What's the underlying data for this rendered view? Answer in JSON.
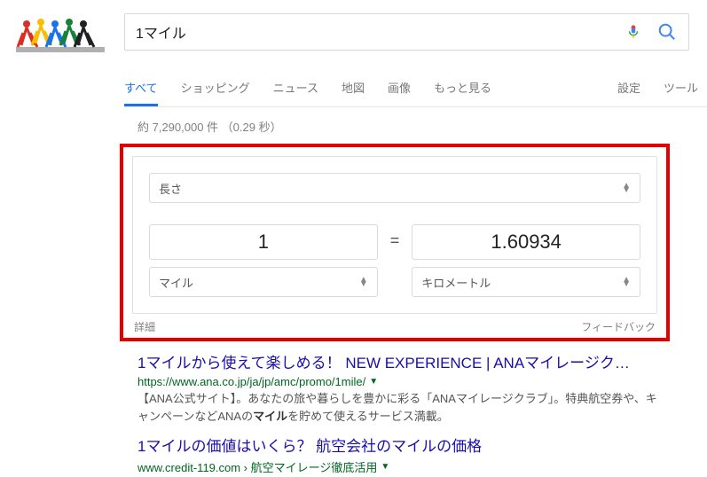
{
  "search": {
    "query": "1マイル"
  },
  "tabs": {
    "all": "すべて",
    "shopping": "ショッピング",
    "news": "ニュース",
    "maps": "地図",
    "images": "画像",
    "more": "もっと見る",
    "settings": "設定",
    "tools": "ツール"
  },
  "stats": "約 7,290,000 件 （0.29 秒）",
  "converter": {
    "category": "長さ",
    "value_from": "1",
    "unit_from": "マイル",
    "equals": "=",
    "value_to": "1.60934",
    "unit_to": "キロメートル",
    "details": "詳細",
    "feedback": "フィードバック"
  },
  "results": [
    {
      "title": "1マイルから使えて楽しめる！ NEW EXPERIENCE | ANAマイレージク…",
      "url": "https://www.ana.co.jp/ja/jp/amc/promo/1mile/",
      "snippet_pre": "【ANA公式サイト】。あなたの旅や暮らしを豊かに彩る「ANAマイレージクラブ」。特典航空券や、キャンペーンなどANAの",
      "snippet_em": "マイル",
      "snippet_post": "を貯めて使えるサービス満載。"
    },
    {
      "title": "1マイルの価値はいくら？ 航空会社のマイルの価格",
      "url": "www.credit-119.com › 航空マイレージ徹底活用",
      "snippet_pre": "",
      "snippet_em": "",
      "snippet_post": ""
    }
  ]
}
